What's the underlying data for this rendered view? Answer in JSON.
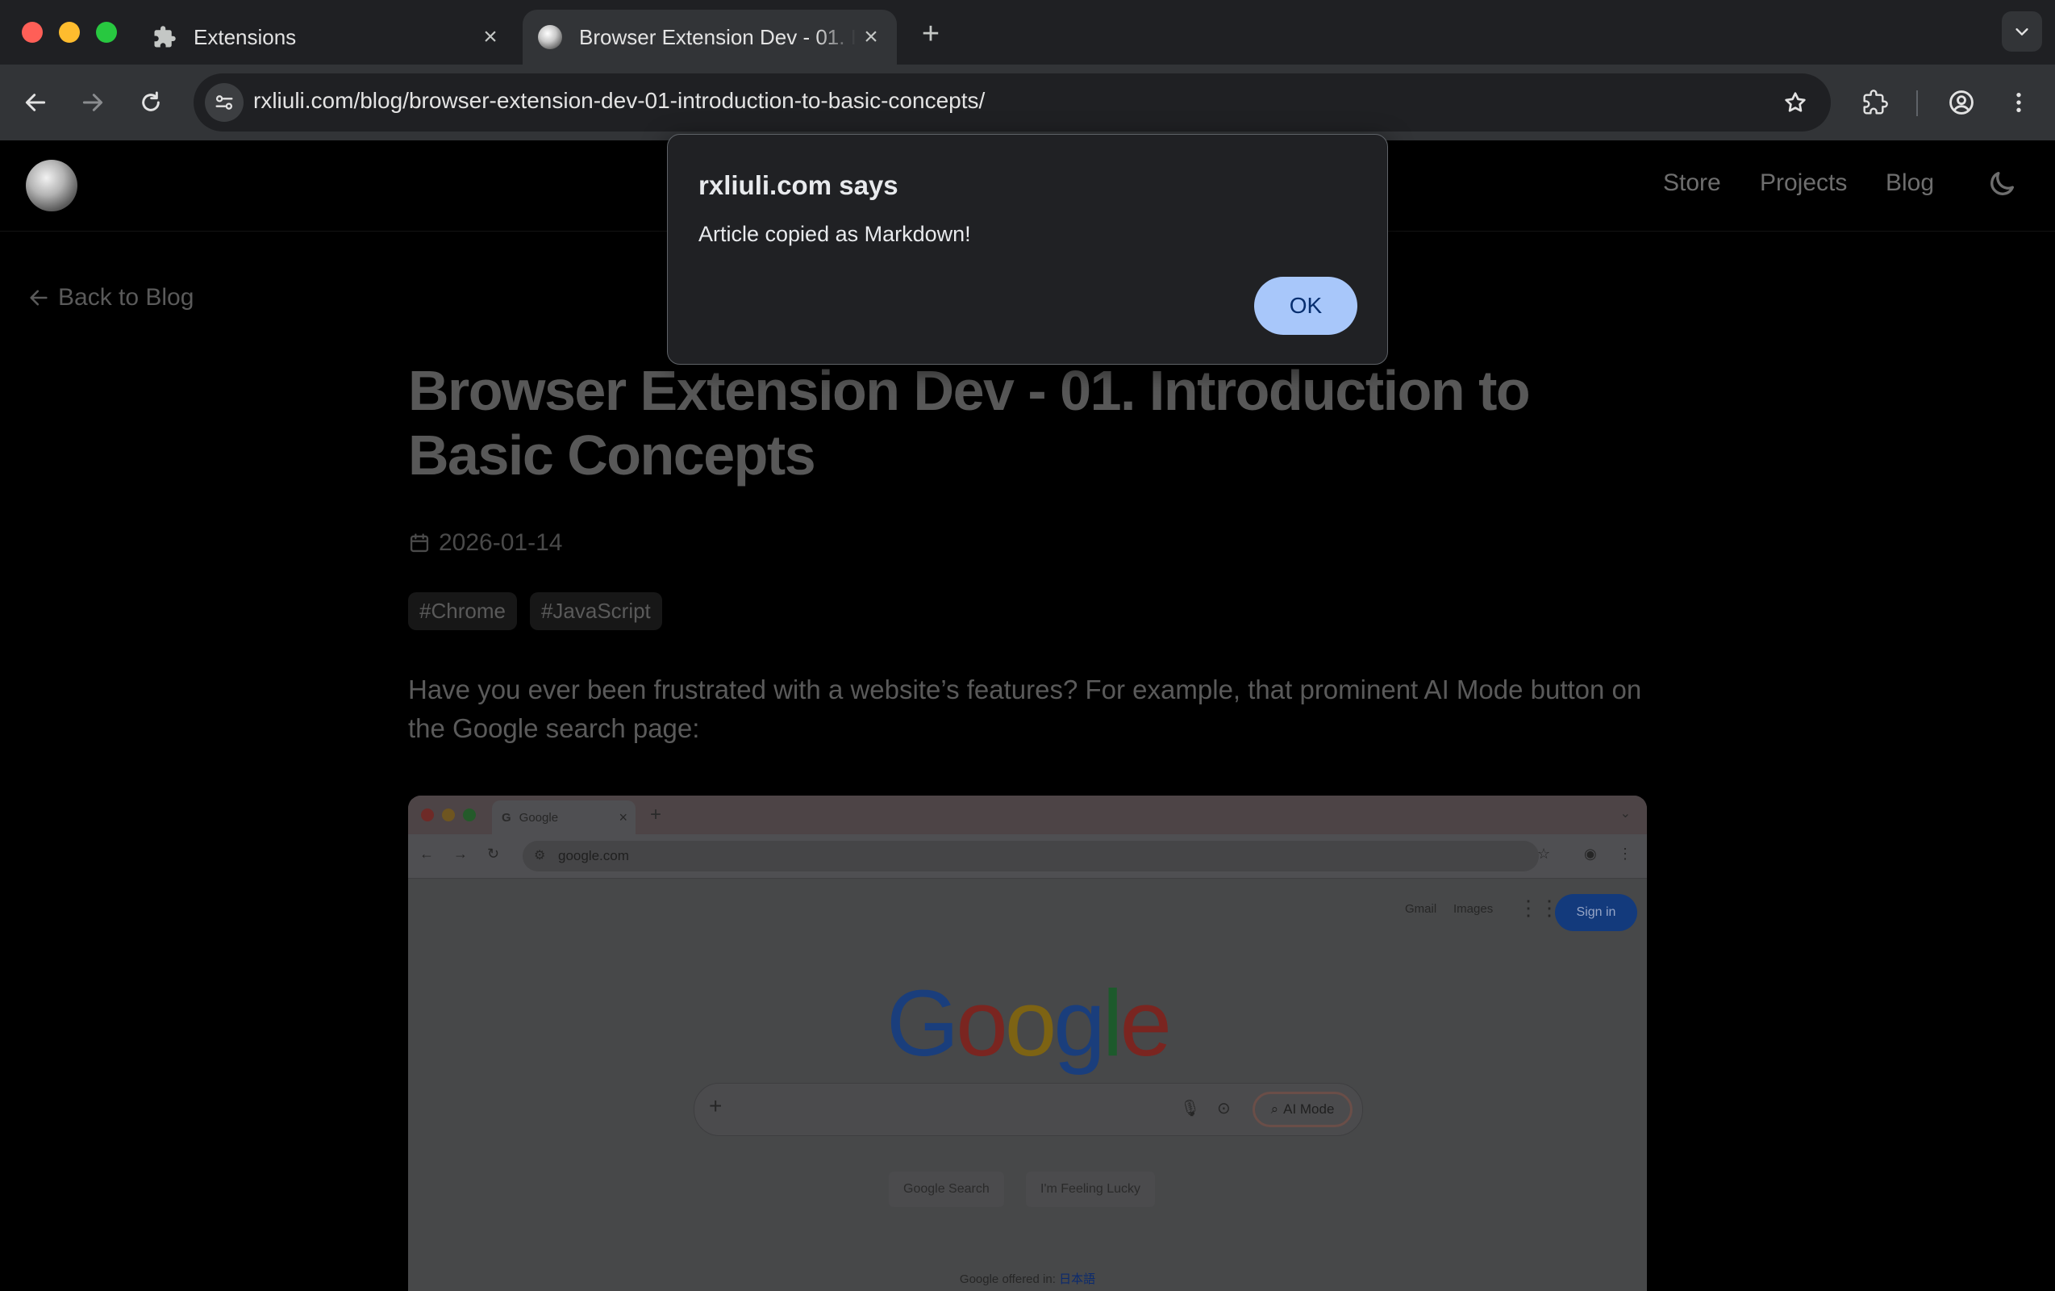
{
  "browser": {
    "tabs": [
      {
        "title": "Extensions",
        "active": false
      },
      {
        "title": "Browser Extension Dev - 01. Introduction to Basic Concepts",
        "active": true
      }
    ],
    "url": "rxliuli.com/blog/browser-extension-dev-01-introduction-to-basic-concepts/"
  },
  "site": {
    "nav": [
      "Store",
      "Projects",
      "Blog"
    ],
    "back_link": "Back to Blog"
  },
  "article": {
    "title": "Browser Extension Dev - 01. Introduction to Basic Concepts",
    "date": "2026-01-14",
    "tags": [
      "#Chrome",
      "#JavaScript"
    ],
    "lead": "Have you ever been frustrated with a website’s features? For example, that prominent AI Mode button on the Google search page:"
  },
  "screenshot": {
    "tab_title": "Google",
    "url": "google.com",
    "top_links": [
      "Gmail",
      "Images"
    ],
    "sign_in": "Sign in",
    "logo_letters": [
      {
        "ch": "G",
        "color": "#1a3e7c"
      },
      {
        "ch": "o",
        "color": "#7a2520"
      },
      {
        "ch": "o",
        "color": "#7d6313"
      },
      {
        "ch": "g",
        "color": "#1a3e7c"
      },
      {
        "ch": "l",
        "color": "#1d5a2c"
      },
      {
        "ch": "e",
        "color": "#7a2520"
      }
    ],
    "ai_mode": "AI Mode",
    "buttons": [
      "Google Search",
      "I'm Feeling Lucky"
    ],
    "offered_label": "Google offered in:",
    "offered_lang": "日本語"
  },
  "dialog": {
    "title": "rxliuli.com says",
    "message": "Article copied as Markdown!",
    "ok_label": "OK"
  },
  "colors": {
    "dialog_bg": "#202124",
    "ok_button": "#a8c7fa",
    "toolbar": "#323437",
    "tabstrip": "#1f2023"
  }
}
